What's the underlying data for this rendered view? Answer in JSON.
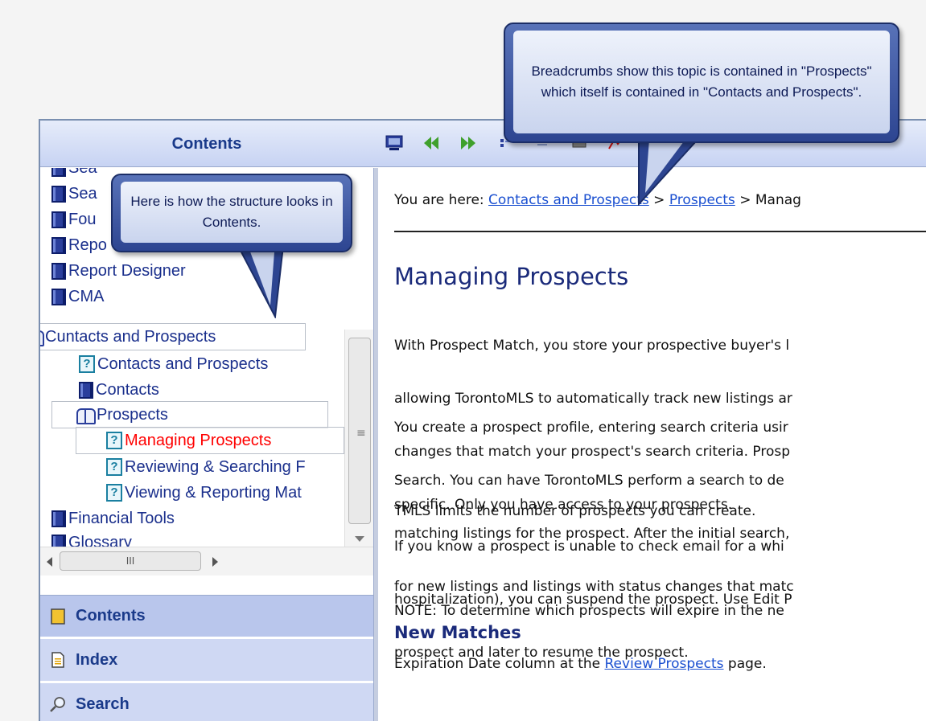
{
  "sidebar": {
    "title": "Contents",
    "tree": [
      {
        "label": "Sea",
        "icon": "book-icon"
      },
      {
        "label": "Sea",
        "icon": "book-icon"
      },
      {
        "label": "Fou",
        "icon": "book-icon"
      },
      {
        "label": "Repo",
        "icon": "book-icon"
      },
      {
        "label": "Report Designer",
        "icon": "book-icon"
      },
      {
        "label": "CMA",
        "icon": "book-icon"
      },
      {
        "label": "Cuntacts and Prospects",
        "icon": "open-book-icon"
      },
      {
        "label": "Contacts and Prospects",
        "icon": "topic-icon"
      },
      {
        "label": "Contacts",
        "icon": "book-icon"
      },
      {
        "label": "Prospects",
        "icon": "open-book-icon"
      },
      {
        "label": "Managing Prospects",
        "icon": "topic-icon",
        "active": true
      },
      {
        "label": "Reviewing & Searching F",
        "icon": "topic-icon"
      },
      {
        "label": "Viewing & Reporting Mat",
        "icon": "topic-icon"
      },
      {
        "label": "Financial Tools",
        "icon": "book-icon"
      },
      {
        "label": "Glossary",
        "icon": "book-icon"
      }
    ],
    "hscroll_glyph": "III",
    "vscroll_glyph": "≡",
    "nav": {
      "contents": "Contents",
      "index": "Index",
      "search": "Search"
    }
  },
  "toolbar": {
    "icons": [
      "monitor-icon",
      "back-icon",
      "forward-icon",
      "sync-toc-icon",
      "hide-icon",
      "print-icon",
      "highlight-icon"
    ]
  },
  "content": {
    "breadcrumb": {
      "prefix": "You are here: ",
      "link1": "Contacts and Prospects",
      "sep": " > ",
      "link2": "Prospects",
      "current": "Manag"
    },
    "title": "Managing Prospects",
    "p1": [
      "With Prospect Match, you store your prospective buyer's l",
      "allowing TorontoMLS to automatically track new listings ar",
      "changes that match your prospect's search criteria. Prosp",
      "specific. Only you have access to your prospects."
    ],
    "p2": [
      "You create a prospect profile, entering search criteria usir",
      "Search. You can have TorontoMLS perform a search to de",
      "matching listings for the prospect. After the initial search,",
      "for new listings and listings with status changes that matc"
    ],
    "p3": "TMLS limits the number of prospects you can create.",
    "p4": [
      "If you know a prospect is unable to check email for a whi",
      "hospitalization), you can suspend the prospect. Use Edit P",
      "prospect and later to resume the prospect."
    ],
    "p5_line1": "NOTE: To determine which prospects will expire in the ne",
    "p5_line2_prefix": "Expiration Date column at the ",
    "p5_link": "Review Prospects",
    "p5_line2_suffix": " page.",
    "subheading": "New Matches"
  },
  "callouts": {
    "breadcrumbs": "Breadcrumbs show this topic is contained in \"Prospects\" which itself is contained in \"Contacts and Prospects\".",
    "structure": "Here is how the structure looks in Contents."
  },
  "colors": {
    "accent": "#1a3a8a",
    "active_topic": "#ff0000",
    "link": "#1a4fd0",
    "callout": "#2d4591"
  }
}
